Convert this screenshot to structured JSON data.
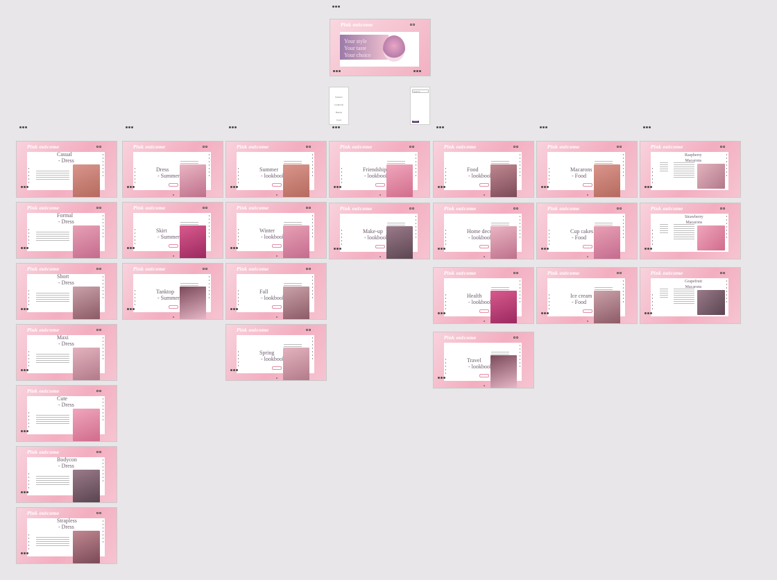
{
  "brand": "Pink outcome",
  "hero": {
    "lines": [
      "Your style",
      "Your taste",
      "Your choice"
    ]
  },
  "mini_menu": [
    "Fashion",
    "Lookbook",
    "Beauty",
    "Food"
  ],
  "mini_search": {
    "placeholder": "Search",
    "button": "Search"
  },
  "columns": [
    {
      "items": [
        {
          "title": "Casual\n - Dress"
        },
        {
          "title": "Formal\n - Dress"
        },
        {
          "title": "Short\n - Dress"
        },
        {
          "title": "Maxi\n - Dress"
        },
        {
          "title": "Cute\n - Dress"
        },
        {
          "title": "Bodycon\n - Dress"
        },
        {
          "title": "Strapless\n - Dress"
        }
      ]
    },
    {
      "items": [
        {
          "title": "Dress\n - Summer"
        },
        {
          "title": "Skirt\n - Summer"
        },
        {
          "title": "Tanktop\n - Summer"
        }
      ]
    },
    {
      "items": [
        {
          "title": "Summer\n - lookbook"
        },
        {
          "title": "Winter\n - lookbook"
        },
        {
          "title": "Fall\n - lookbook"
        },
        {
          "title": "Spring\n - lookbook"
        }
      ]
    },
    {
      "items": [
        {
          "title": "Friendship\n - lookbook"
        },
        {
          "title": "Make-up\n - lookbook"
        }
      ]
    },
    {
      "items": [
        {
          "title": "Food\n - lookbook"
        },
        {
          "title": "Home decor\n - lookbook"
        },
        {
          "title": "Health\n - lookbook"
        },
        {
          "title": "Travel\n - lookbook"
        }
      ]
    },
    {
      "items": [
        {
          "title": "Macarons\n - Food"
        },
        {
          "title": "Cup cakes\n - Food"
        },
        {
          "title": "Ice cream\n - Food"
        }
      ]
    },
    {
      "items": [
        {
          "title": "Raspberry\nMacarons"
        },
        {
          "title": "Strawberry\nMacarons"
        },
        {
          "title": "Grapefruit\nMacarons"
        }
      ]
    }
  ],
  "colors": {
    "canvas": "#e8e6e8",
    "frame_pink": "#f3aec0",
    "accent": "#e48ca6",
    "title_text": "#6a5a6c"
  }
}
